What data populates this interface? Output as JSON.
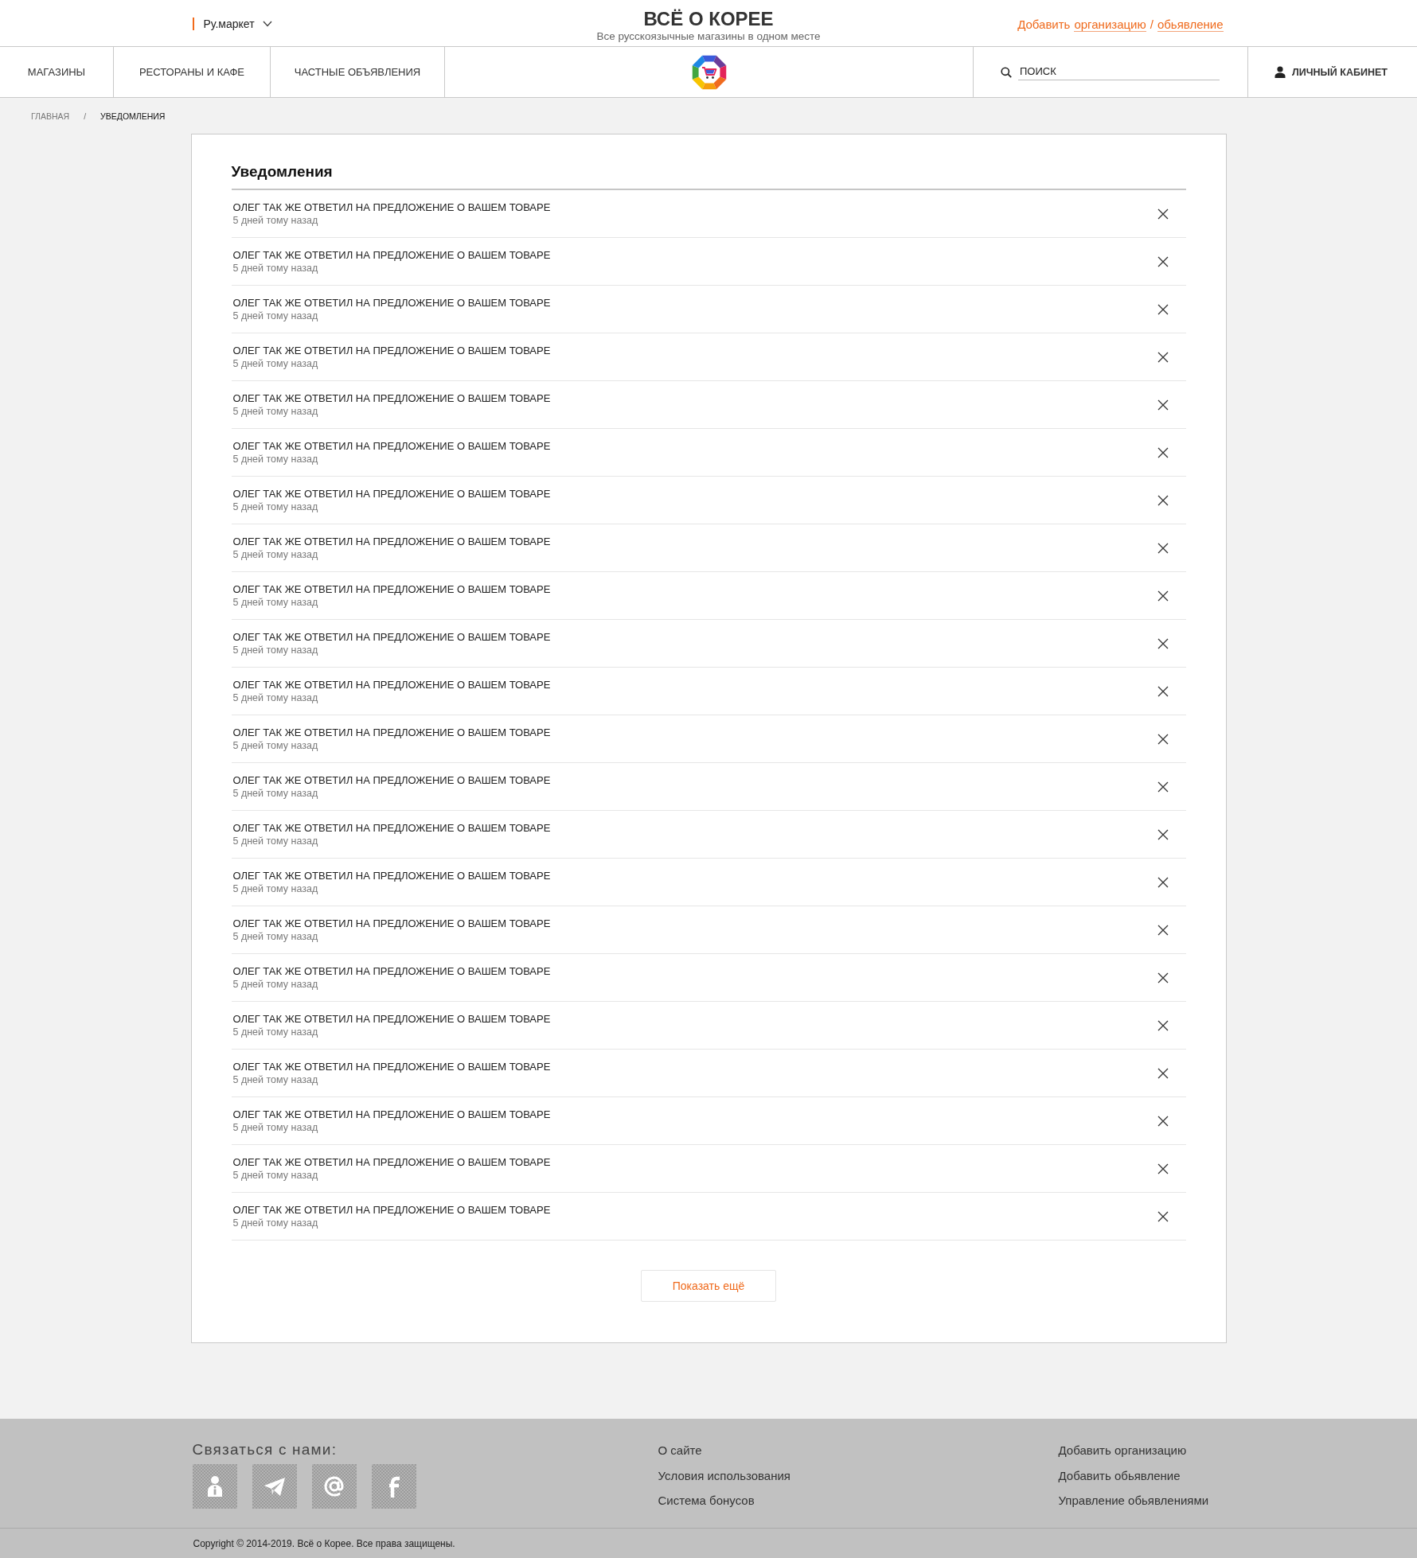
{
  "header": {
    "region_selector": {
      "label": "Ру.маркет"
    },
    "site_title": "ВСЁ О КОРЕЕ",
    "tagline": "Все русскоязычные магазины в одном месте",
    "add_links": [
      {
        "kind": "text",
        "text": "Добавить"
      },
      {
        "kind": "link",
        "text": "организацию"
      },
      {
        "kind": "text",
        "text": "/"
      },
      {
        "kind": "link",
        "text": "обьявление"
      }
    ]
  },
  "nav": {
    "items": [
      {
        "label": "МАГАЗИНЫ"
      },
      {
        "label": "РЕСТОРАНЫ И КАФЕ"
      },
      {
        "label": "ЧАСТНЫЕ ОБЪЯВЛЕНИЯ"
      }
    ],
    "search": {
      "placeholder": "ПОИСК"
    },
    "account": {
      "label": "ЛИЧНЫЙ КАБИНЕТ"
    }
  },
  "breadcrumb": {
    "separator": "/",
    "items": [
      {
        "label": "ГЛАВНАЯ",
        "current": false
      },
      {
        "label": "УВЕДОМЛЕНИЯ",
        "current": true
      }
    ]
  },
  "notifications": {
    "title": "Уведомления",
    "items": [
      {
        "text": "ОЛЕГ ТАК ЖЕ ОТВЕТИЛ НА ПРЕДЛОЖЕНИЕ О ВАШЕМ ТОВАРЕ",
        "time": "5 дней тому назад"
      },
      {
        "text": "ОЛЕГ ТАК ЖЕ ОТВЕТИЛ НА ПРЕДЛОЖЕНИЕ О ВАШЕМ ТОВАРЕ",
        "time": "5 дней тому назад"
      },
      {
        "text": "ОЛЕГ ТАК ЖЕ ОТВЕТИЛ НА ПРЕДЛОЖЕНИЕ О ВАШЕМ ТОВАРЕ",
        "time": "5 дней тому назад"
      },
      {
        "text": "ОЛЕГ ТАК ЖЕ ОТВЕТИЛ НА ПРЕДЛОЖЕНИЕ О ВАШЕМ ТОВАРЕ",
        "time": "5 дней тому назад"
      },
      {
        "text": "ОЛЕГ ТАК ЖЕ ОТВЕТИЛ НА ПРЕДЛОЖЕНИЕ О ВАШЕМ ТОВАРЕ",
        "time": "5 дней тому назад"
      },
      {
        "text": "ОЛЕГ ТАК ЖЕ ОТВЕТИЛ НА ПРЕДЛОЖЕНИЕ О ВАШЕМ ТОВАРЕ",
        "time": "5 дней тому назад"
      },
      {
        "text": "ОЛЕГ ТАК ЖЕ ОТВЕТИЛ НА ПРЕДЛОЖЕНИЕ О ВАШЕМ ТОВАРЕ",
        "time": "5 дней тому назад"
      },
      {
        "text": "ОЛЕГ ТАК ЖЕ ОТВЕТИЛ НА ПРЕДЛОЖЕНИЕ О ВАШЕМ ТОВАРЕ",
        "time": "5 дней тому назад"
      },
      {
        "text": "ОЛЕГ ТАК ЖЕ ОТВЕТИЛ НА ПРЕДЛОЖЕНИЕ О ВАШЕМ ТОВАРЕ",
        "time": "5 дней тому назад"
      },
      {
        "text": "ОЛЕГ ТАК ЖЕ ОТВЕТИЛ НА ПРЕДЛОЖЕНИЕ О ВАШЕМ ТОВАРЕ",
        "time": "5 дней тому назад"
      },
      {
        "text": "ОЛЕГ ТАК ЖЕ ОТВЕТИЛ НА ПРЕДЛОЖЕНИЕ О ВАШЕМ ТОВАРЕ",
        "time": "5 дней тому назад"
      },
      {
        "text": "ОЛЕГ ТАК ЖЕ ОТВЕТИЛ НА ПРЕДЛОЖЕНИЕ О ВАШЕМ ТОВАРЕ",
        "time": "5 дней тому назад"
      },
      {
        "text": "ОЛЕГ ТАК ЖЕ ОТВЕТИЛ НА ПРЕДЛОЖЕНИЕ О ВАШЕМ ТОВАРЕ",
        "time": "5 дней тому назад"
      },
      {
        "text": "ОЛЕГ ТАК ЖЕ ОТВЕТИЛ НА ПРЕДЛОЖЕНИЕ О ВАШЕМ ТОВАРЕ",
        "time": "5 дней тому назад"
      },
      {
        "text": "ОЛЕГ ТАК ЖЕ ОТВЕТИЛ НА ПРЕДЛОЖЕНИЕ О ВАШЕМ ТОВАРЕ",
        "time": "5 дней тому назад"
      },
      {
        "text": "ОЛЕГ ТАК ЖЕ ОТВЕТИЛ НА ПРЕДЛОЖЕНИЕ О ВАШЕМ ТОВАРЕ",
        "time": "5 дней тому назад"
      },
      {
        "text": "ОЛЕГ ТАК ЖЕ ОТВЕТИЛ НА ПРЕДЛОЖЕНИЕ О ВАШЕМ ТОВАРЕ",
        "time": "5 дней тому назад"
      },
      {
        "text": "ОЛЕГ ТАК ЖЕ ОТВЕТИЛ НА ПРЕДЛОЖЕНИЕ О ВАШЕМ ТОВАРЕ",
        "time": "5 дней тому назад"
      },
      {
        "text": "ОЛЕГ ТАК ЖЕ ОТВЕТИЛ НА ПРЕДЛОЖЕНИЕ О ВАШЕМ ТОВАРЕ",
        "time": "5 дней тому назад"
      },
      {
        "text": "ОЛЕГ ТАК ЖЕ ОТВЕТИЛ НА ПРЕДЛОЖЕНИЕ О ВАШЕМ ТОВАРЕ",
        "time": "5 дней тому назад"
      },
      {
        "text": "ОЛЕГ ТАК ЖЕ ОТВЕТИЛ НА ПРЕДЛОЖЕНИЕ О ВАШЕМ ТОВАРЕ",
        "time": "5 дней тому назад"
      },
      {
        "text": "ОЛЕГ ТАК ЖЕ ОТВЕТИЛ НА ПРЕДЛОЖЕНИЕ О ВАШЕМ ТОВАРЕ",
        "time": "5 дней тому назад"
      }
    ],
    "show_more": "Показать ещё"
  },
  "footer": {
    "contact_title": "Связаться с нами:",
    "links_column_1": [
      "О сайте",
      "Условия использования",
      "Система бонусов"
    ],
    "links_column_2": [
      "Добавить организацию",
      "Добавить обьявление",
      "Управление обьявлениями"
    ],
    "copyright": "Copyright © 2014-2019. Всё о Корее. Все права защищены."
  }
}
